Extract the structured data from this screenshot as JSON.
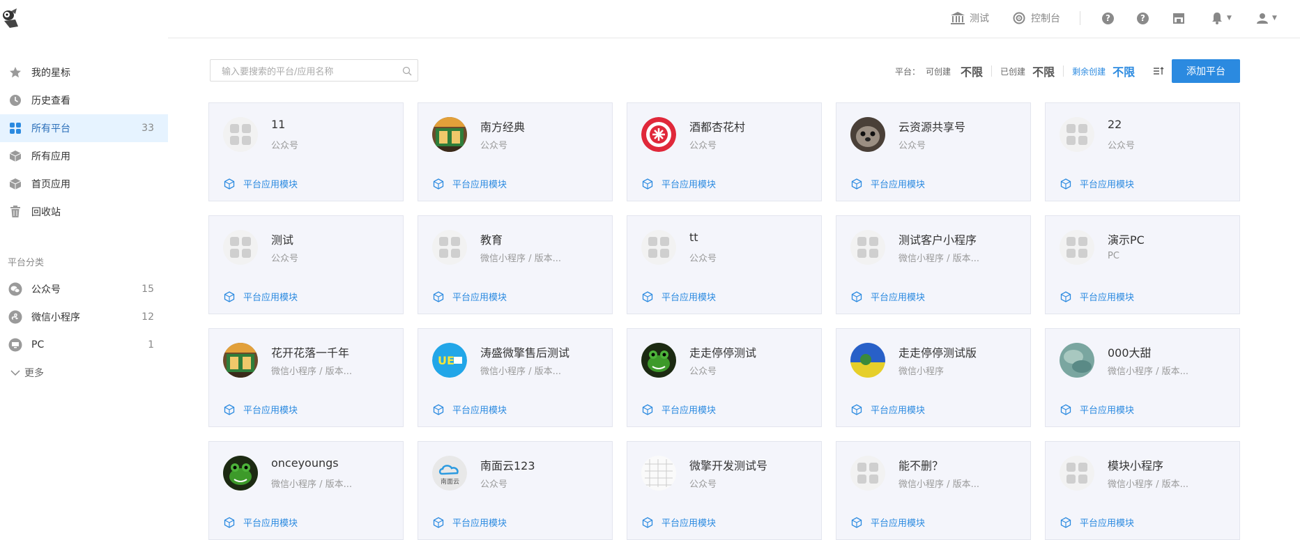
{
  "topbar": {
    "nav_test": "测试",
    "nav_console": "控制台",
    "icons": [
      "bank-icon",
      "target-icon",
      "help-icon",
      "help-icon",
      "store-icon",
      "bell-icon",
      "user-icon"
    ]
  },
  "sidebar": {
    "items": [
      {
        "label": "我的星标",
        "icon": "star-icon",
        "count": ""
      },
      {
        "label": "历史查看",
        "icon": "clock-icon",
        "count": ""
      },
      {
        "label": "所有平台",
        "icon": "grid-icon",
        "count": "33",
        "active": true
      },
      {
        "label": "所有应用",
        "icon": "cube-icon",
        "count": ""
      },
      {
        "label": "首页应用",
        "icon": "cube-icon",
        "count": ""
      },
      {
        "label": "回收站",
        "icon": "trash-icon",
        "count": ""
      }
    ],
    "category_title": "平台分类",
    "categories": [
      {
        "label": "公众号",
        "icon": "wechat-icon",
        "count": "15"
      },
      {
        "label": "微信小程序",
        "icon": "miniprogram-icon",
        "count": "12"
      },
      {
        "label": "PC",
        "icon": "pc-icon",
        "count": "1"
      }
    ],
    "more_label": "更多"
  },
  "search": {
    "placeholder": "输入要搜索的平台/应用名称",
    "value": ""
  },
  "stats": {
    "platform_label": "平台：",
    "can_create_label": "可创建",
    "can_create_value": "不限",
    "created_label": "已创建",
    "created_value": "不限",
    "remaining_label": "剩余创建",
    "remaining_value": "不限"
  },
  "add_button": "添加平台",
  "module_label": "平台应用模块",
  "cards": [
    {
      "title": "11",
      "sub": "公众号",
      "avatar": "placeholder"
    },
    {
      "title": "南方经典",
      "sub": "公众号",
      "avatar": "shopfront"
    },
    {
      "title": "酒都杏花村",
      "sub": "公众号",
      "avatar": "red-seal"
    },
    {
      "title": "云资源共享号",
      "sub": "公众号",
      "avatar": "seal-animal"
    },
    {
      "title": "22",
      "sub": "公众号",
      "avatar": "placeholder"
    },
    {
      "title": "测试",
      "sub": "公众号",
      "avatar": "placeholder"
    },
    {
      "title": "教育",
      "sub": "微信小程序 / 版本...",
      "avatar": "placeholder"
    },
    {
      "title": "tt",
      "sub": "公众号",
      "avatar": "placeholder"
    },
    {
      "title": "测试客户小程序",
      "sub": "微信小程序 / 版本...",
      "avatar": "placeholder"
    },
    {
      "title": "演示PC",
      "sub": "PC",
      "avatar": "placeholder"
    },
    {
      "title": "花开花落一千年",
      "sub": "微信小程序 / 版本...",
      "avatar": "shopfront"
    },
    {
      "title": "涛盛微擎售后测试",
      "sub": "微信小程序 / 版本...",
      "avatar": "ue-logo"
    },
    {
      "title": "走走停停测试",
      "sub": "公众号",
      "avatar": "frog"
    },
    {
      "title": "走走停停测试版",
      "sub": "微信小程序",
      "avatar": "field"
    },
    {
      "title": "000大甜",
      "sub": "微信小程序 / 版本...",
      "avatar": "sea"
    },
    {
      "title": "onceyoungs",
      "sub": "微信小程序 / 版本...",
      "avatar": "frog"
    },
    {
      "title": "南面云123",
      "sub": "公众号",
      "avatar": "cloud-logo"
    },
    {
      "title": "微擎开发测试号",
      "sub": "公众号",
      "avatar": "grid-sketch"
    },
    {
      "title": "能不删？",
      "sub": "微信小程序 / 版本...",
      "avatar": "placeholder"
    },
    {
      "title": "模块小程序",
      "sub": "微信小程序 / 版本...",
      "avatar": "placeholder"
    }
  ],
  "avatar_texts": {
    "cloud": "南面云"
  },
  "colors": {
    "accent": "#2b8ae0",
    "card_bg": "#f4f5fb",
    "active_bg": "#e6f3ff"
  }
}
